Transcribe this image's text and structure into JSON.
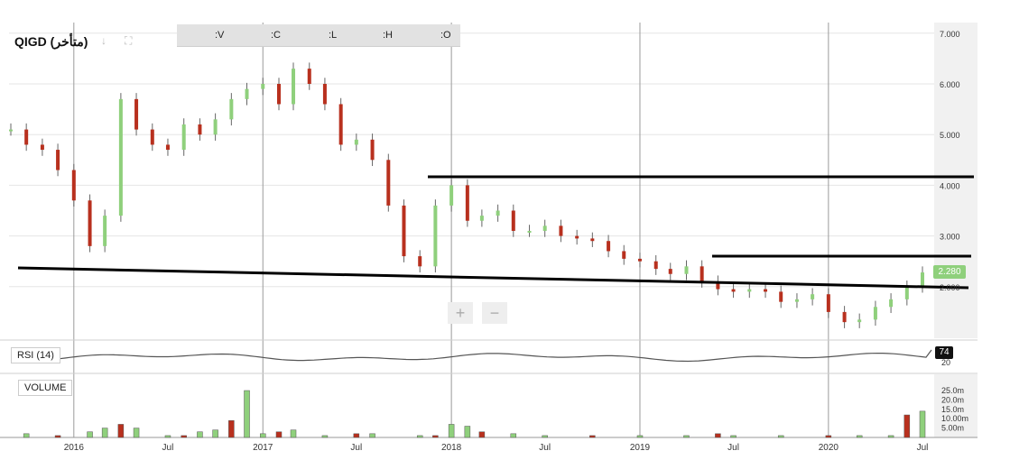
{
  "header": {
    "ticker": "QIGD (متأخر)",
    "ohlc_labels": [
      ":V",
      ":C",
      ":L",
      ":H",
      ":O"
    ]
  },
  "price_axis": {
    "ticks": [
      "7.000",
      "6.000",
      "5.000",
      "4.000",
      "3.000",
      "2.000"
    ]
  },
  "rsi_panel": {
    "label": "RSI (14)",
    "current_value": "74",
    "axis_tick": "20"
  },
  "volume_panel": {
    "label": "VOLUME",
    "ticks": [
      "25.0m",
      "20.0m",
      "15.0m",
      "10.00m",
      "5.00m"
    ]
  },
  "last_price_badge": "2.280",
  "zoom_controls": {
    "plus": "+",
    "minus": "−"
  },
  "x_axis_labels": [
    "2016",
    "Jul",
    "2017",
    "Jul",
    "2018",
    "Jul",
    "2019",
    "Jul",
    "2020",
    "Jul"
  ],
  "colors": {
    "up": "#8fd07c",
    "down": "#b8301e",
    "rsi_line": "#555555",
    "trend_line": "#000000"
  },
  "chart_data": {
    "type": "line",
    "title": "QIGD (متأخر)",
    "y_range": [
      1.0,
      7.0
    ],
    "x_labels": [
      "2016",
      "Jul",
      "2017",
      "Jul",
      "2018",
      "Jul",
      "2019",
      "Jul",
      "2020",
      "Jul"
    ],
    "series": [
      {
        "x": [
          "2015-09",
          "2015-10",
          "2015-11",
          "2015-12",
          "2016-01",
          "2016-02",
          "2016-03",
          "2016-04",
          "2016-05",
          "2016-06",
          "2016-07",
          "2016-08",
          "2016-09",
          "2016-10",
          "2016-11",
          "2016-12",
          "2017-01",
          "2017-02",
          "2017-03",
          "2017-04",
          "2017-05",
          "2017-06",
          "2017-07",
          "2017-08",
          "2017-09",
          "2017-10",
          "2017-11",
          "2017-12",
          "2018-01",
          "2018-02",
          "2018-03",
          "2018-04",
          "2018-05",
          "2018-06",
          "2018-07",
          "2018-08",
          "2018-09",
          "2018-10",
          "2018-11",
          "2018-12",
          "2019-01",
          "2019-02",
          "2019-03",
          "2019-04",
          "2019-05",
          "2019-06",
          "2019-07",
          "2019-08",
          "2019-09",
          "2019-10",
          "2019-11",
          "2019-12",
          "2020-01",
          "2020-02",
          "2020-03",
          "2020-04",
          "2020-05",
          "2020-06",
          "2020-07"
        ],
        "y": [
          5.1,
          4.8,
          4.7,
          4.3,
          3.7,
          2.8,
          3.4,
          5.7,
          5.1,
          4.8,
          4.7,
          5.2,
          5.0,
          5.3,
          5.7,
          5.9,
          6.0,
          5.6,
          6.3,
          6.0,
          5.6,
          4.8,
          4.9,
          4.5,
          3.6,
          2.6,
          2.4,
          3.6,
          4.0,
          3.3,
          3.4,
          3.5,
          3.1,
          3.1,
          3.2,
          3.0,
          2.95,
          2.9,
          2.7,
          2.55,
          2.5,
          2.35,
          2.25,
          2.4,
          2.1,
          1.95,
          1.9,
          1.95,
          1.9,
          1.7,
          1.75,
          1.85,
          1.5,
          1.3,
          1.35,
          1.6,
          1.75,
          2.0,
          2.28
        ]
      }
    ],
    "volume": {
      "ylim": [
        0,
        30
      ],
      "x": [
        "2015-10",
        "2015-12",
        "2016-02",
        "2016-03",
        "2016-04",
        "2016-05",
        "2016-07",
        "2016-08",
        "2016-09",
        "2016-10",
        "2016-11",
        "2016-12",
        "2017-01",
        "2017-02",
        "2017-03",
        "2017-05",
        "2017-07",
        "2017-08",
        "2017-11",
        "2017-12",
        "2018-01",
        "2018-02",
        "2018-03",
        "2018-05",
        "2018-07",
        "2018-10",
        "2019-01",
        "2019-04",
        "2019-06",
        "2019-07",
        "2019-10",
        "2020-01",
        "2020-03",
        "2020-05",
        "2020-06",
        "2020-07"
      ],
      "y": [
        2,
        1,
        3,
        5,
        7,
        5,
        1,
        1,
        3,
        4,
        9,
        25,
        2,
        3,
        4,
        1,
        2,
        2,
        1,
        1,
        7,
        6,
        3,
        2,
        1,
        1,
        1,
        1,
        2,
        1,
        1,
        1,
        1,
        1,
        12,
        14
      ]
    },
    "rsi": {
      "current": 74
    }
  }
}
